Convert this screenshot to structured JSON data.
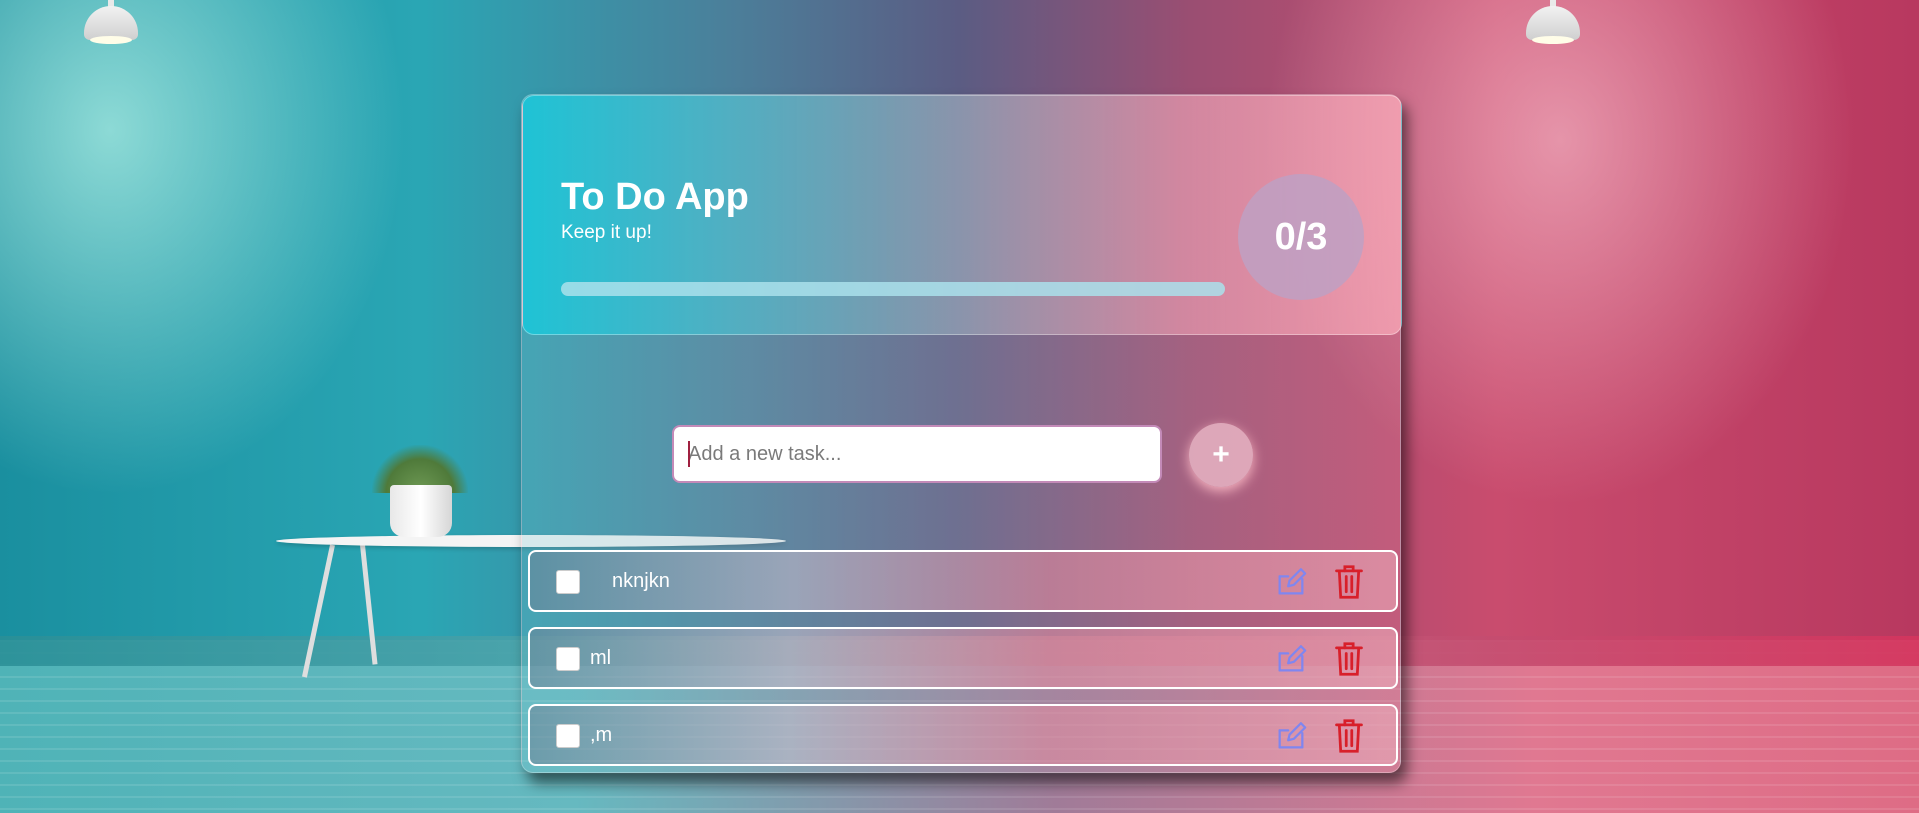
{
  "app": {
    "title": "To Do App",
    "subtitle": "Keep it up!",
    "counter": "0/3",
    "progress_fraction": 0
  },
  "input": {
    "placeholder": "Add a new task...",
    "value": ""
  },
  "add_button": {
    "label": "+"
  },
  "tasks": [
    {
      "text": "nknjkn",
      "checked": false
    },
    {
      "text": "ml",
      "checked": false
    },
    {
      "text": ",m",
      "checked": false
    }
  ],
  "colors": {
    "edit_icon": "#7f86f0",
    "delete_icon": "#d81f2a"
  },
  "icons": {
    "edit": "edit-icon",
    "delete": "trash-icon"
  }
}
